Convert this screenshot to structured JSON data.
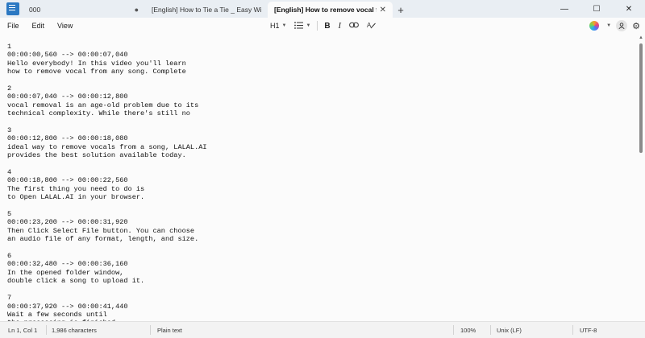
{
  "tabs": [
    {
      "title": "000",
      "modified_marker": "●"
    },
    {
      "title": "[English] How to Tie a Tie _ Easy Windsor Knot"
    },
    {
      "title": "[English] How to remove vocal from any song",
      "active": true,
      "close": "✕"
    }
  ],
  "new_tab": "+",
  "window_controls": {
    "minimize": "—",
    "maximize": "☐",
    "close": "✕"
  },
  "menu": [
    "File",
    "Edit",
    "View"
  ],
  "formatting": {
    "heading": "H1",
    "list_icon": "list-icon",
    "bold": "B",
    "italic": "I",
    "link_icon": "link-icon",
    "clear_format_icon": "clear-format-icon"
  },
  "document": {
    "blocks": [
      {
        "index": "1",
        "time": "00:00:00,560 --> 00:00:07,040",
        "lines": [
          "Hello everybody! In this video you'll learn",
          "how to remove vocal from any song. Complete"
        ]
      },
      {
        "index": "2",
        "time": "00:00:07,040 --> 00:00:12,800",
        "lines": [
          "vocal removal is an age-old problem due to its",
          "technical complexity. While there's still no"
        ]
      },
      {
        "index": "3",
        "time": "00:00:12,800 --> 00:00:18,080",
        "lines": [
          "ideal way to remove vocals from a song, LALAL.AI",
          "provides the best solution available today."
        ]
      },
      {
        "index": "4",
        "time": "00:00:18,800 --> 00:00:22,560",
        "lines": [
          "The first thing you need to do is",
          "to Open LALAL.AI in your browser."
        ]
      },
      {
        "index": "5",
        "time": "00:00:23,200 --> 00:00:31,920",
        "lines": [
          "Then Click Select File button. You can choose",
          "an audio file of any format, length, and size."
        ]
      },
      {
        "index": "6",
        "time": "00:00:32,480 --> 00:00:36,160",
        "lines": [
          "In the opened folder window,",
          "double click a song to upload it."
        ]
      },
      {
        "index": "7",
        "time": "00:00:37,920 --> 00:00:41,440",
        "lines": [
          "Wait a few seconds until",
          "the processing is finished"
        ]
      }
    ]
  },
  "status": {
    "position": "Ln 1, Col 1",
    "characters": "1,986 characters",
    "format": "Plain text",
    "zoom": "100%",
    "line_ending": "Unix (LF)",
    "encoding": "UTF-8"
  }
}
